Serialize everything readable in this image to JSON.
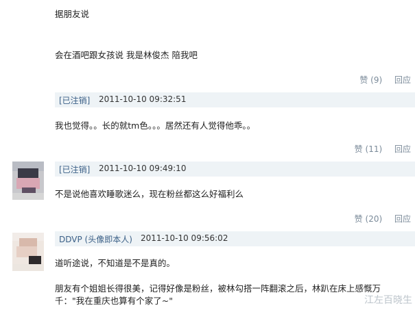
{
  "comments": [
    {
      "lines": [
        "据朋友说",
        "会在酒吧跟女孩说 我是林俊杰 陪我吧"
      ],
      "like_label": "赞",
      "like_count": "(9)",
      "reply_label": "回应"
    },
    {
      "user": "[已注销]",
      "time": "2011-10-10 09:32:51",
      "text": "我也觉得。。长的就tm色。。。居然还有人觉得他乖。。",
      "like_label": "赞",
      "like_count": "(11)",
      "reply_label": "回应"
    },
    {
      "user": "[已注销]",
      "time": "2011-10-10 09:49:10",
      "text": "不是说他喜欢睡歌迷么，现在粉丝都这么好福利么",
      "like_label": "赞",
      "like_count": "(20)",
      "reply_label": "回应"
    },
    {
      "user": "DDVP (头像即本人)",
      "time": "2011-10-10 09:56:02",
      "lines": [
        "道听途说，不知道是不是真的。",
        "朋友有个姐姐长得很美，记得好像是粉丝，被林勾搭一阵翻滚之后，林趴在床上感慨万千：\"我在重庆也算有个家了~\""
      ]
    }
  ],
  "watermark": "江左百晓生"
}
